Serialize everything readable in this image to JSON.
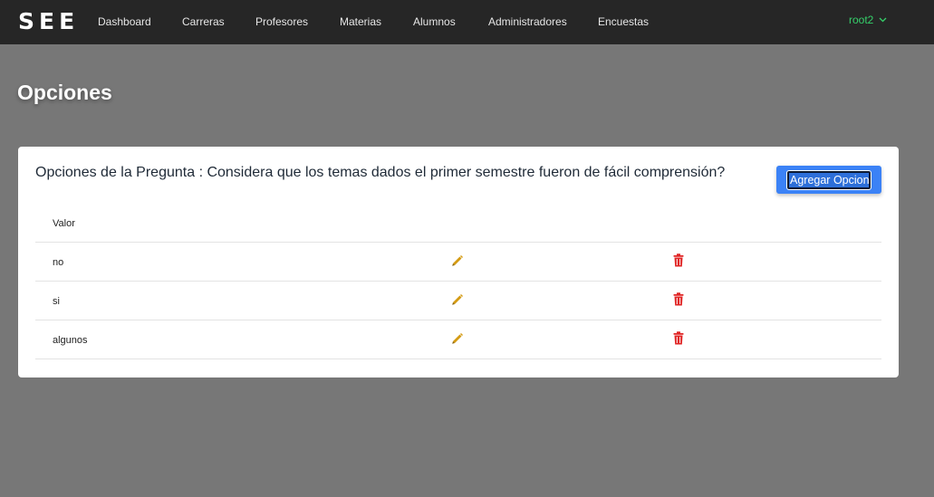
{
  "navbar": {
    "brand": "SEE",
    "items": [
      {
        "label": "Dashboard"
      },
      {
        "label": "Carreras"
      },
      {
        "label": "Profesores"
      },
      {
        "label": "Materias"
      },
      {
        "label": "Alumnos"
      },
      {
        "label": "Administradores"
      },
      {
        "label": "Encuestas"
      }
    ],
    "user": "root2",
    "user_icon": "chevron-down-icon"
  },
  "page": {
    "title": "Opciones"
  },
  "card": {
    "title": "Opciones de la Pregunta : Considera que los temas dados el primer semestre fueron de fácil comprensión?",
    "add_button": "Agregar Opcion",
    "table": {
      "header": "Valor",
      "rows": [
        {
          "value": "no"
        },
        {
          "value": "si"
        },
        {
          "value": "algunos"
        }
      ]
    }
  },
  "colors": {
    "navbar_bg": "#262626",
    "page_bg": "#777777",
    "user_accent": "#35d06a",
    "primary_button": "#3b82f6",
    "edit_icon": "#d49a12",
    "delete_icon": "#e02424"
  }
}
